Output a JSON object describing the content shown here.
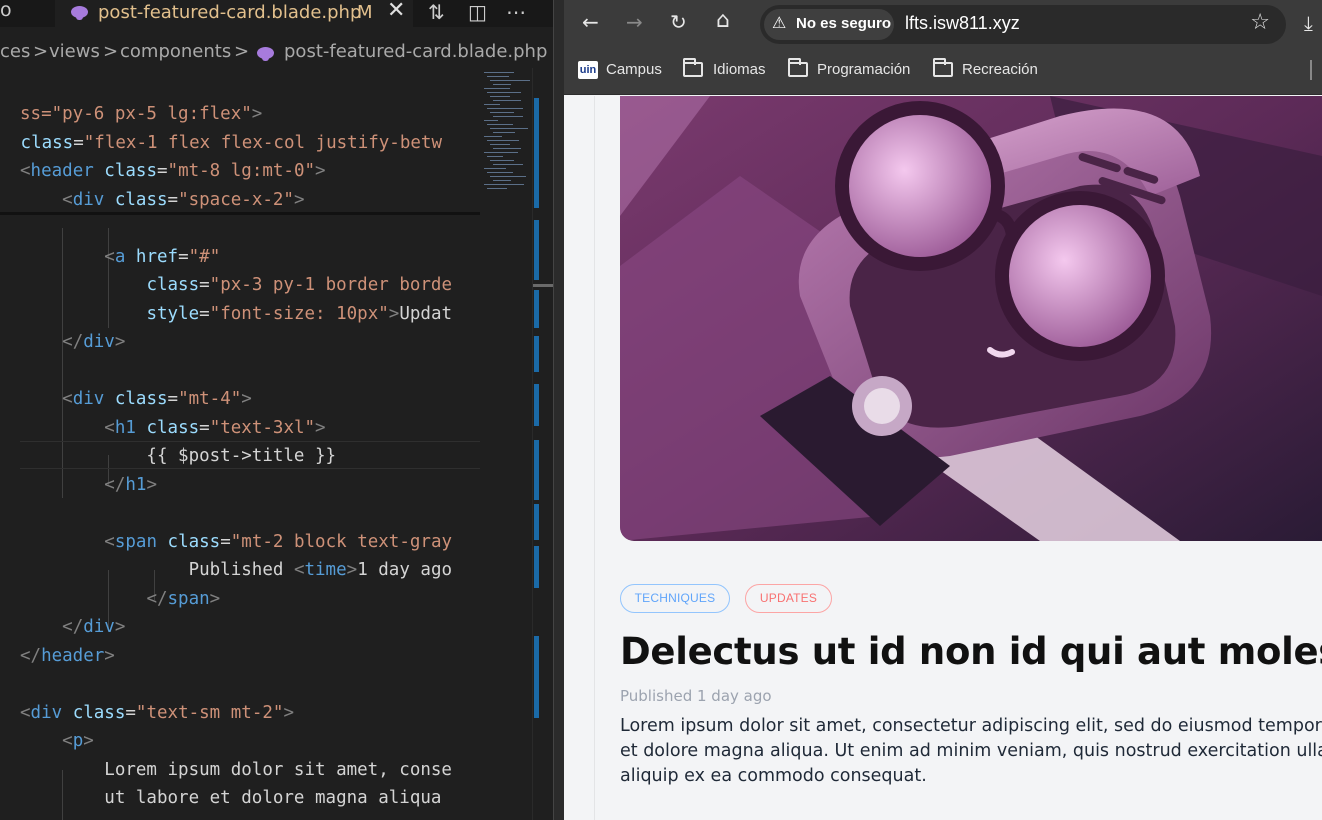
{
  "editor_tab": {
    "prev_tab_fragment": "o",
    "file_name": "post-featured-card.blade.php",
    "modified_marker": "M",
    "close_glyph": "✕"
  },
  "editor_actions": {
    "compare_icon": "⇅",
    "split_icon": "◫",
    "more_icon": "⋯"
  },
  "breadcrumbs": {
    "items": [
      "ces",
      "views",
      "components",
      "post-featured-card.blade.php"
    ],
    "separator": ">"
  },
  "code_lines": [
    [
      [
        "s",
        "ss=\"py-6 px-5 lg:flex\""
      ],
      [
        "p",
        ">"
      ]
    ],
    [
      [
        "a",
        " class"
      ],
      [
        "w",
        "="
      ],
      [
        "s",
        "\"flex-1 flex flex-col justify-betw"
      ]
    ],
    [
      [
        "p",
        "<"
      ],
      [
        "t",
        "header"
      ],
      [
        "a",
        " class"
      ],
      [
        "w",
        "="
      ],
      [
        "s",
        "\"mt-8 lg:mt-0\""
      ],
      [
        "p",
        ">"
      ]
    ],
    [
      [
        "w",
        "    "
      ],
      [
        "p",
        "<"
      ],
      [
        "t",
        "div"
      ],
      [
        "a",
        " class"
      ],
      [
        "w",
        "="
      ],
      [
        "s",
        "\"space-x-2\""
      ],
      [
        "p",
        ">"
      ]
    ],
    [
      [
        "w",
        "        "
      ]
    ],
    [
      [
        "w",
        "        "
      ],
      [
        "p",
        "<"
      ],
      [
        "t",
        "a"
      ],
      [
        "a",
        " href"
      ],
      [
        "w",
        "="
      ],
      [
        "s",
        "\"#\""
      ]
    ],
    [
      [
        "w",
        "            "
      ],
      [
        "a",
        "class"
      ],
      [
        "w",
        "="
      ],
      [
        "s",
        "\"px-3 py-1 border borde"
      ]
    ],
    [
      [
        "w",
        "            "
      ],
      [
        "a",
        "style"
      ],
      [
        "w",
        "="
      ],
      [
        "s",
        "\"font-size: 10px\""
      ],
      [
        "p",
        ">"
      ],
      [
        "w",
        "Updat"
      ]
    ],
    [
      [
        "w",
        "    "
      ],
      [
        "p",
        "</"
      ],
      [
        "t",
        "div"
      ],
      [
        "p",
        ">"
      ]
    ],
    [
      [
        "w",
        ""
      ]
    ],
    [
      [
        "w",
        "    "
      ],
      [
        "p",
        "<"
      ],
      [
        "t",
        "div"
      ],
      [
        "a",
        " class"
      ],
      [
        "w",
        "="
      ],
      [
        "s",
        "\"mt-4\""
      ],
      [
        "p",
        ">"
      ]
    ],
    [
      [
        "w",
        "        "
      ],
      [
        "p",
        "<"
      ],
      [
        "t",
        "h1"
      ],
      [
        "a",
        " class"
      ],
      [
        "w",
        "="
      ],
      [
        "s",
        "\"text-3xl\""
      ],
      [
        "p",
        ">"
      ]
    ],
    [
      [
        "w",
        "            {{ $post->title }}"
      ]
    ],
    [
      [
        "w",
        "        "
      ],
      [
        "p",
        "</"
      ],
      [
        "t",
        "h1"
      ],
      [
        "p",
        ">"
      ]
    ],
    [
      [
        "w",
        ""
      ]
    ],
    [
      [
        "w",
        "        "
      ],
      [
        "p",
        "<"
      ],
      [
        "t",
        "span"
      ],
      [
        "a",
        " class"
      ],
      [
        "w",
        "="
      ],
      [
        "s",
        "\"mt-2 block text-gray"
      ]
    ],
    [
      [
        "w",
        "                Published "
      ],
      [
        "p",
        "<"
      ],
      [
        "t",
        "time"
      ],
      [
        "p",
        ">"
      ],
      [
        "w",
        "1 day ago"
      ]
    ],
    [
      [
        "w",
        "            "
      ],
      [
        "p",
        "</"
      ],
      [
        "t",
        "span"
      ],
      [
        "p",
        ">"
      ]
    ],
    [
      [
        "w",
        "    "
      ],
      [
        "p",
        "</"
      ],
      [
        "t",
        "div"
      ],
      [
        "p",
        ">"
      ]
    ],
    [
      [
        "p",
        "</"
      ],
      [
        "t",
        "header"
      ],
      [
        "p",
        ">"
      ]
    ],
    [
      [
        "w",
        ""
      ]
    ],
    [
      [
        "p",
        "<"
      ],
      [
        "t",
        "div"
      ],
      [
        "a",
        " class"
      ],
      [
        "w",
        "="
      ],
      [
        "s",
        "\"text-sm mt-2\""
      ],
      [
        "p",
        ">"
      ]
    ],
    [
      [
        "w",
        "    "
      ],
      [
        "p",
        "<"
      ],
      [
        "t",
        "p"
      ],
      [
        "p",
        ">"
      ]
    ],
    [
      [
        "w",
        "        Lorem ipsum dolor sit amet, conse"
      ]
    ],
    [
      [
        "w",
        "        ut labore et dolore magna aliqua"
      ]
    ]
  ],
  "browser": {
    "back_icon": "←",
    "forward_icon": "→",
    "reload_icon": "↻",
    "home_icon": "⌂",
    "warning_icon": "⚠",
    "security_label": "No es seguro",
    "url": "lfts.isw811.xyz",
    "star_icon": "☆",
    "download_icon": "⤓",
    "bookmarks": [
      {
        "label": "Campus",
        "icon": "uin"
      },
      {
        "label": "Idiomas",
        "icon": "folder"
      },
      {
        "label": "Programación",
        "icon": "folder"
      },
      {
        "label": "Recreación",
        "icon": "folder"
      }
    ]
  },
  "post": {
    "tags": [
      "TECHNIQUES",
      "UPDATES"
    ],
    "title": "Delectus ut id non id qui aut molestias.",
    "published": "Published 1 day ago",
    "body_lines": [
      "Lorem ipsum dolor sit amet, consectetur adipiscing elit, sed do eiusmod tempor incidid",
      "et dolore magna aliqua. Ut enim ad minim veniam, quis nostrud exercitation ullamco la",
      "aliquip ex ea commodo consequat."
    ]
  },
  "colors": {
    "tag_techniques": "#60a5fa",
    "tag_updates": "#f87171",
    "editor_bg": "#1f1f1f",
    "browser_chrome": "#3b3b3b",
    "modified_file": "#e2c08d"
  }
}
